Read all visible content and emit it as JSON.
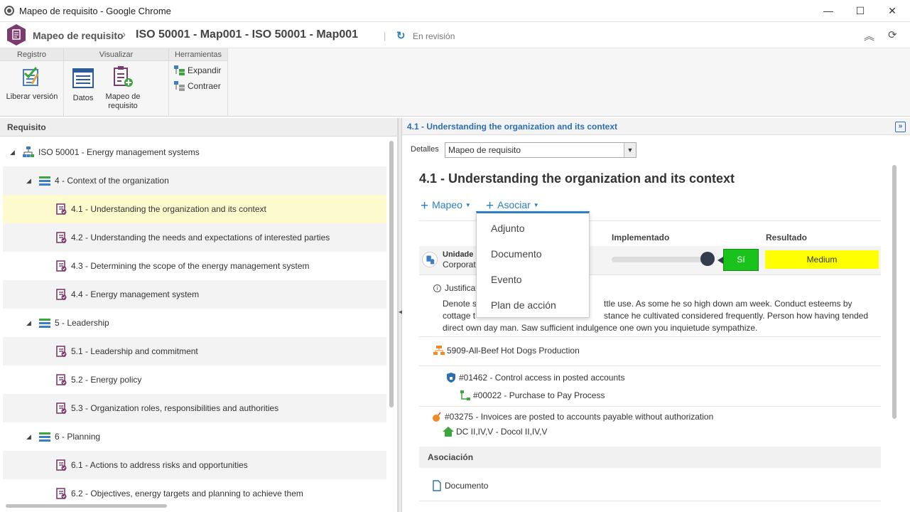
{
  "window": {
    "title": "Mapeo de requisito - Google Chrome",
    "minimize": "—",
    "maximize": "☐",
    "close": "✕"
  },
  "header": {
    "app_name": "Mapeo de requisito",
    "separator": "›",
    "record_title": "ISO 50001 - Map001 - ISO 50001 - Map001",
    "divider": "|",
    "status_icon": "↻",
    "status": "En revisión",
    "collapse_icon": "︽",
    "refresh_icon": "⟳"
  },
  "ribbon": {
    "groups": {
      "registro": "Registro",
      "visualizar": "Visualizar",
      "herramientas": "Herramientas"
    },
    "liberar": "Liberar versión",
    "datos": "Datos",
    "mapeo_line1": "Mapeo de",
    "mapeo_line2": "requisito",
    "expandir": "Expandir",
    "contraer": "Contraer"
  },
  "left": {
    "header": "Requisito",
    "tree": [
      {
        "label": "ISO 50001 - Energy management systems",
        "level": 0,
        "toggle": "◢",
        "icon": "hierarchy-icon"
      },
      {
        "label": "4 - Context of the organization",
        "level": 1,
        "toggle": "◢",
        "icon": "group-icon"
      },
      {
        "label": "4.1 - Understanding the organization and its context",
        "level": 2,
        "toggle": "",
        "icon": "requirement-icon"
      },
      {
        "label": "4.2 - Understanding the needs and expectations of interested parties",
        "level": 2,
        "toggle": "",
        "icon": "requirement-icon"
      },
      {
        "label": "4.3 - Determining the scope of the energy management system",
        "level": 2,
        "toggle": "",
        "icon": "requirement-icon"
      },
      {
        "label": "4.4 - Energy management system",
        "level": 2,
        "toggle": "",
        "icon": "requirement-icon"
      },
      {
        "label": "5 - Leadership",
        "level": 1,
        "toggle": "◢",
        "icon": "group-icon"
      },
      {
        "label": "5.1 - Leadership and commitment",
        "level": 2,
        "toggle": "",
        "icon": "requirement-icon"
      },
      {
        "label": "5.2 - Energy policy",
        "level": 2,
        "toggle": "",
        "icon": "requirement-icon"
      },
      {
        "label": "5.3 - Organization roles, responsibilities and authorities",
        "level": 2,
        "toggle": "",
        "icon": "requirement-icon"
      },
      {
        "label": "6 - Planning",
        "level": 1,
        "toggle": "◢",
        "icon": "group-icon"
      },
      {
        "label": "6.1 - Actions to address risks and opportunities",
        "level": 2,
        "toggle": "",
        "icon": "requirement-icon"
      },
      {
        "label": "6.2 - Objectives, energy targets and planning to achieve them",
        "level": 2,
        "toggle": "",
        "icon": "requirement-icon"
      }
    ]
  },
  "splitter_arrow": "◀",
  "right": {
    "header": "4.1 - Understanding the organization and its context",
    "collapse_icon": "»",
    "details_label": "Detalles",
    "details_value": "Mapeo de requisito",
    "select_arrow": "▼",
    "title": "4.1 - Understanding the organization and its context",
    "btn_plus": "+",
    "btn_caret": "▼",
    "btn_mapeo": "Mapeo",
    "btn_asociar": "Asociar",
    "col_implementado": "Implementado",
    "col_resultado": "Resultado",
    "implementado_level": 0.95,
    "unit_label": "Unidade d",
    "unit_sub": "Corporativ",
    "si": "Sí",
    "resultado": "Medium",
    "justif_icon": "i",
    "justif_title": "Justificat",
    "justif_text_1": "Denote s",
    "justif_text_1b": "ttle use. As some he so high down am week. Conduct esteems by",
    "justif_text_2": "cottage t",
    "justif_text_2b": "stance he cultivated considered frequently. Person how having tended",
    "justif_text_3": "direct own day man. Saw sufficient indulgence one own you inquietude sympathize.",
    "process": "5909-All-Beef Hot Dogs Production",
    "control": "#01462 - Control access in posted accounts",
    "purchase": "#00022 - Purchase to Pay Process",
    "risk": "#03275 - Invoices are posted to accounts payable without authorization",
    "dc": "DC II,IV,V - Docol II,IV,V",
    "asociacion": "Asociación",
    "documento": "Documento"
  },
  "dropdown": {
    "items": [
      "Adjunto",
      "Documento",
      "Evento",
      "Plan de acción"
    ]
  },
  "colors": {
    "accent": "#2c7fc4",
    "si_green": "#19c31c",
    "medium_yellow": "#ffff00",
    "selected_row": "#fdfbcd"
  }
}
